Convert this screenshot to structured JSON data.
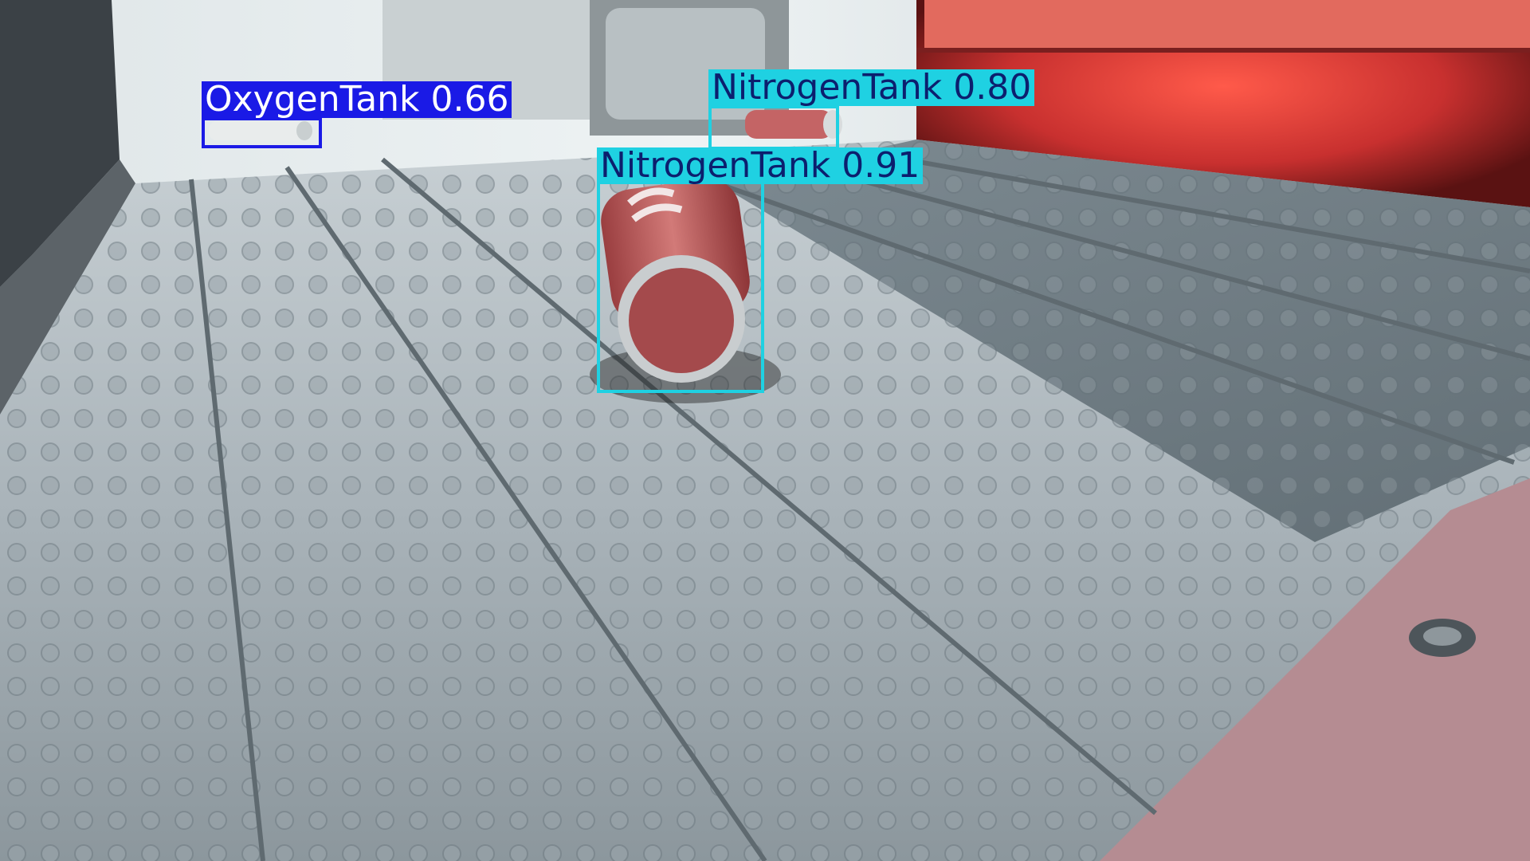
{
  "detections": [
    {
      "label": "OxygenTank 0.66",
      "class": "OxygenTank",
      "confidence": 0.66,
      "color": "#1a1ae6",
      "text_color": "#ffffff"
    },
    {
      "label": "NitrogenTank 0.80",
      "class": "NitrogenTank",
      "confidence": 0.8,
      "color": "#1fd1e2",
      "text_color": "#0c1f6e"
    },
    {
      "label": "NitrogenTank 0.91",
      "class": "NitrogenTank",
      "confidence": 0.91,
      "color": "#1fd1e2",
      "text_color": "#0c1f6e"
    }
  ],
  "scene_colors": {
    "floor": "#aab4ba",
    "floor_dark": "#76848c",
    "wall_red": "#d63a3a",
    "haze": "#e8eef0",
    "tank_red": "#c6585a"
  }
}
